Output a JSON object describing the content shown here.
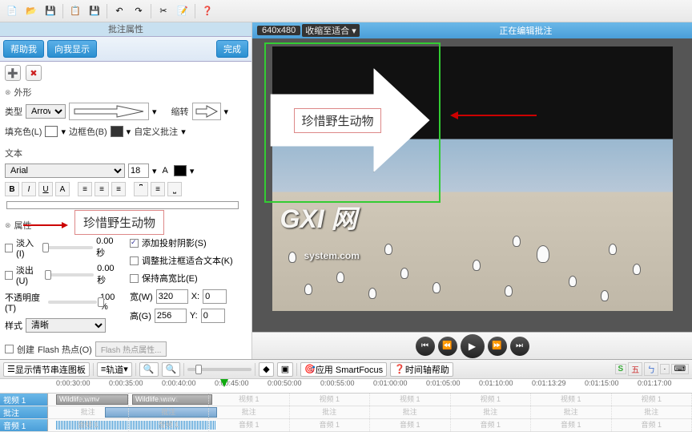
{
  "toolbar": {
    "icons": [
      "new-file",
      "open-folder",
      "save",
      "copy",
      "save-as",
      "undo",
      "redo",
      "cut",
      "settings",
      "help"
    ]
  },
  "left_panel": {
    "title": "批注属性",
    "help_btn": "帮助我",
    "show_btn": "向我显示",
    "done_btn": "完成",
    "section_shape": "外形",
    "type_label": "类型",
    "type_value": "Arrow",
    "rotate_label": "缩转",
    "fill_label": "填充色(L)",
    "border_label": "边框色(B)",
    "custom_label": "自定义批注",
    "section_text": "文本",
    "font_name": "Arial",
    "font_size": "18",
    "editor_text": "珍惜野生动物",
    "section_props": "属性",
    "fade_in": "淡入(I)",
    "fade_out": "淡出(U)",
    "fade_in_val": "0.00 秒",
    "fade_out_val": "0.00 秒",
    "opacity_label": "不透明度(T)",
    "opacity_val": "100 %",
    "style_label": "样式",
    "style_val": "清晰",
    "shadow_label": "添加投射阴影(S)",
    "resize_label": "调整批注框适合文本(K)",
    "aspect_label": "保持高宽比(E)",
    "width_label": "宽(W)",
    "width_val": "320",
    "height_label": "高(G)",
    "height_val": "256",
    "x_label": "X:",
    "x_val": "0",
    "y_label": "Y:",
    "y_val": "0",
    "flash_create": "创建",
    "flash_label": "Flash 热点(O)",
    "flash_props": "Flash 热点属性..."
  },
  "right_panel": {
    "zoom": "640x480",
    "zoom_mode": "收缩至适合",
    "title": "正在编辑批注",
    "callout_text": "珍惜野生动物",
    "watermark": "GXI 网",
    "watermark_sub": "system.com"
  },
  "timeline": {
    "clip_mode": "显示情节串连图板",
    "tracks_btn": "轨道",
    "smartfocus": "应用 SmartFocus",
    "help": "时间轴帮助",
    "ticks": [
      "0:00:30:00",
      "0:00:35:00",
      "0:00:40:00",
      "0:00:45:00",
      "0:00:50:00",
      "0:00:55:00",
      "0:01:00:00",
      "0:01:05:00",
      "0:01:10:00",
      "0:01:13:29",
      "0:01:15:00",
      "0:01:17:00"
    ],
    "track_video": "视频 1",
    "track_callout": "批注",
    "track_audio": "音频 1",
    "clip_name": "Wildlife.wmv",
    "marker_v": "视频 1",
    "marker_c": "批注",
    "marker_a": "音频 1",
    "ime": [
      "S",
      "五",
      "ㄅ",
      "·",
      "⌨"
    ]
  },
  "colors": {
    "fill": "#ffffff",
    "border": "#333333",
    "text": "#000000"
  },
  "chart_data": null
}
